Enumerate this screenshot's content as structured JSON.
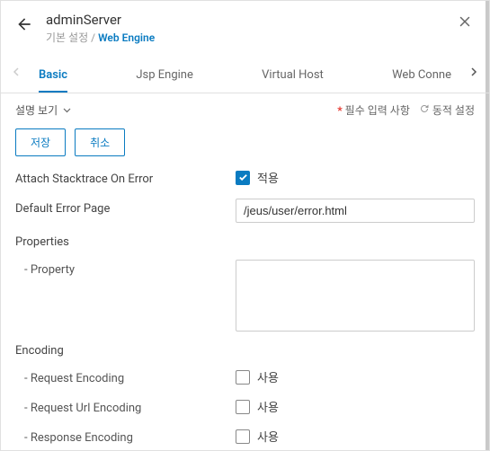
{
  "header": {
    "title": "adminServer",
    "breadcrumb_parent": "기본 설정",
    "breadcrumb_sep": "/",
    "breadcrumb_current": "Web Engine"
  },
  "tabs": {
    "items": [
      "Basic",
      "Jsp Engine",
      "Virtual Host",
      "Web Conne"
    ],
    "active_index": 0
  },
  "toolbar": {
    "desc_toggle": "설명 보기",
    "required_label": "필수 입력 사항",
    "dynamic_label": "동적 설정"
  },
  "actions": {
    "save": "저장",
    "cancel": "취소"
  },
  "form": {
    "attach_stacktrace": {
      "label": "Attach Stacktrace On Error",
      "checked": true,
      "cb_label": "적용"
    },
    "default_error_page": {
      "label": "Default Error Page",
      "value": "/jeus/user/error.html"
    },
    "properties": {
      "label": "Properties",
      "property_label": "- Property",
      "value": ""
    },
    "encoding": {
      "label": "Encoding",
      "request": {
        "label": "- Request Encoding",
        "checked": false,
        "cb_label": "사용"
      },
      "request_url": {
        "label": "- Request Url Encoding",
        "checked": false,
        "cb_label": "사용"
      },
      "response": {
        "label": "- Response Encoding",
        "checked": false,
        "cb_label": "사용"
      }
    }
  }
}
